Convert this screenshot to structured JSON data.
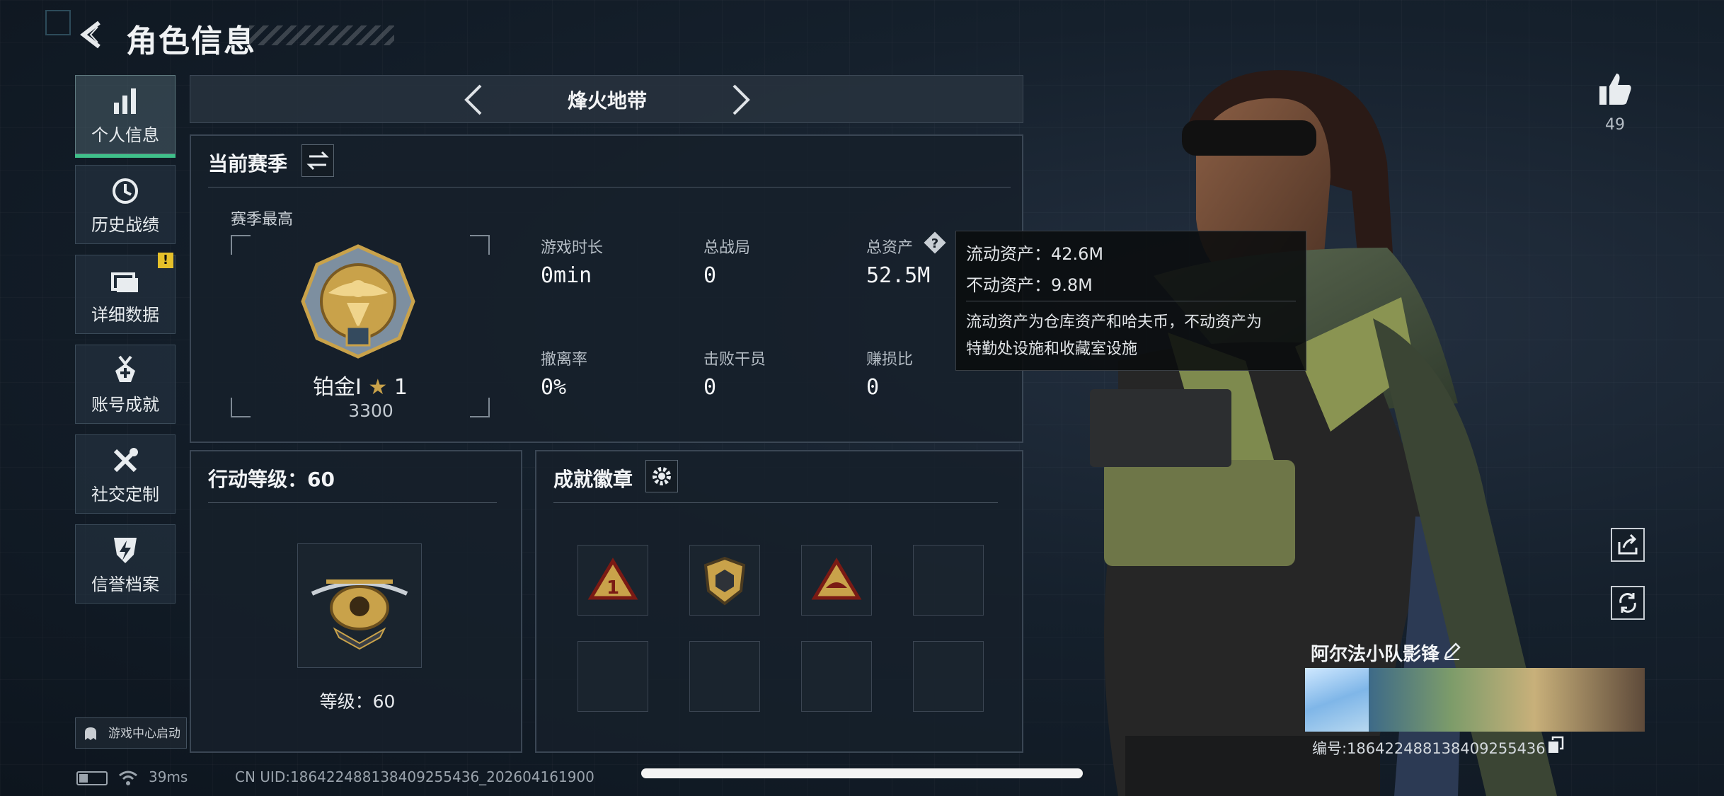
{
  "header": {
    "title": "角色信息"
  },
  "sidebar": {
    "items": [
      {
        "label": "个人信息",
        "icon": "bar-chart-icon",
        "active": true
      },
      {
        "label": "历史战绩",
        "icon": "history-clock-icon"
      },
      {
        "label": "详细数据",
        "icon": "folder-icon",
        "badge": "!"
      },
      {
        "label": "账号成就",
        "icon": "medal-icon"
      },
      {
        "label": "社交定制",
        "icon": "tools-icon"
      },
      {
        "label": "信誉档案",
        "icon": "shield-bolt-icon"
      }
    ],
    "game_center": "游戏中心启动"
  },
  "mode": {
    "title": "烽火地带"
  },
  "season": {
    "title": "当前赛季",
    "best_label": "赛季最高",
    "rank_name": "铂金Ⅰ",
    "rank_stars": "1",
    "rank_score": "3300",
    "stats": [
      {
        "label": "游戏时长",
        "value": "0min"
      },
      {
        "label": "总战局",
        "value": "0"
      },
      {
        "label": "总资产",
        "value": "52.5M"
      },
      {
        "label": "撤离率",
        "value": "0%"
      },
      {
        "label": "击败干员",
        "value": "0"
      },
      {
        "label": "赚损比",
        "value": "0"
      }
    ]
  },
  "tooltip": {
    "liquid": "流动资产：42.6M",
    "fixed": "不动资产：9.8M",
    "desc_line1": "流动资产为仓库资产和哈夫币，不动资产为",
    "desc_line2": "特勤处设施和收藏室设施"
  },
  "level": {
    "title": "行动等级：60",
    "label": "等级：60"
  },
  "achievements": {
    "title": "成就徽章"
  },
  "player": {
    "likes": "49",
    "name": "阿尔法小队影锋",
    "id": "编号:186422488138409255436"
  },
  "footer": {
    "ping": "39ms",
    "uid": "CN UID:186422488138409255436_202604161900"
  },
  "colors": {
    "accent": "#3fc08a",
    "badge": "#e5c02a",
    "gold": "#c9a24a"
  }
}
